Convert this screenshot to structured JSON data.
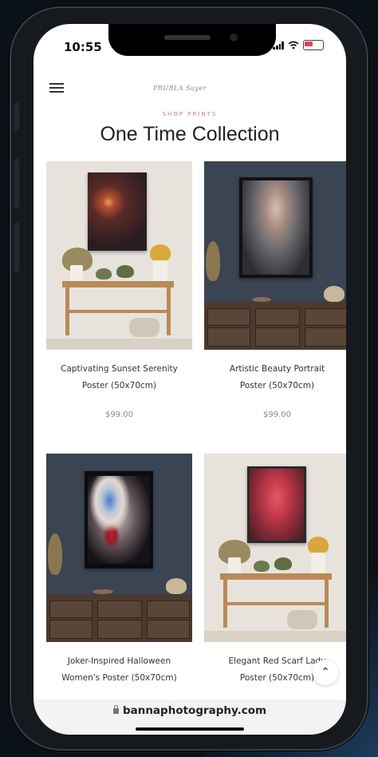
{
  "status_bar": {
    "time": "10:55"
  },
  "header": {
    "logo": "PRUBLA Sayer"
  },
  "section": {
    "eyebrow": "SHOP PRINTS",
    "title": "One Time Collection"
  },
  "products": [
    {
      "name_line1": "Captivating Sunset Serenity",
      "name_line2": "Poster (50x70cm)",
      "price": "$99.00"
    },
    {
      "name_line1": "Artistic Beauty Portrait",
      "name_line2": "Poster (50x70cm)",
      "price": "$99.00"
    },
    {
      "name_line1": "Joker-Inspired Halloween",
      "name_line2": "Women's Poster (50x70cm)",
      "price": ""
    },
    {
      "name_line1": "Elegant Red Scarf Lady",
      "name_line2": "Poster (50x70cm)",
      "price": ""
    }
  ],
  "browser": {
    "url": "bannaphotography.com"
  },
  "icons": [
    "menu-icon",
    "lock-icon",
    "chevron-up-icon",
    "signal-icon",
    "wifi-icon",
    "battery-icon"
  ]
}
